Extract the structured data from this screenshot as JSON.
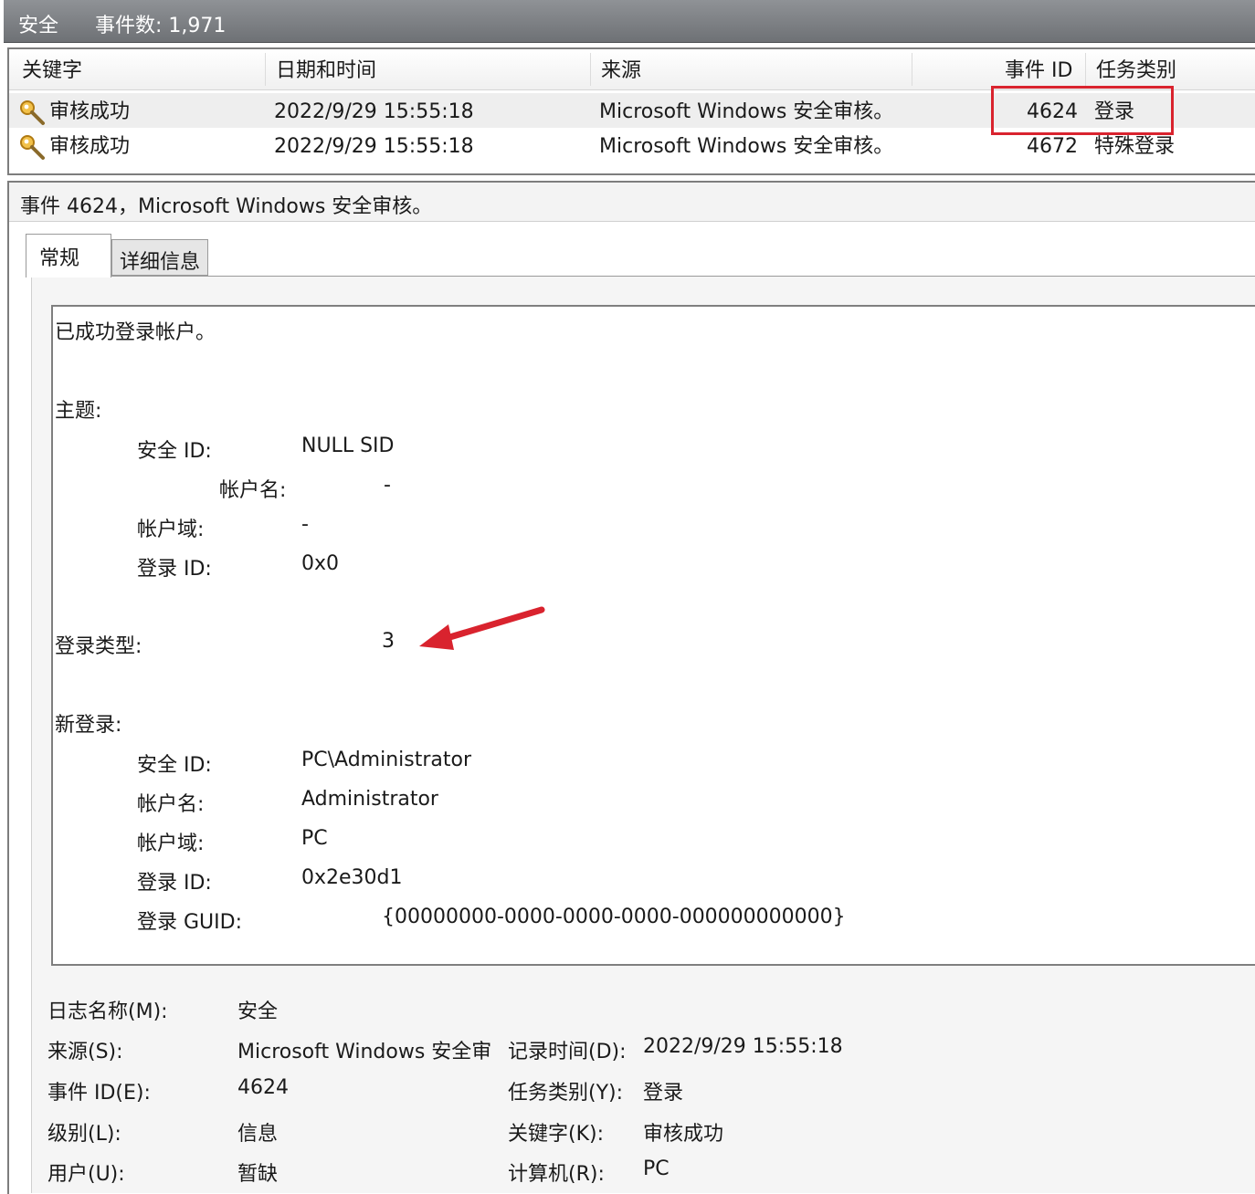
{
  "titlebar": {
    "log_name": "安全",
    "event_count": "事件数: 1,971"
  },
  "list": {
    "columns": {
      "keyword": "关键字",
      "datetime": "日期和时间",
      "source": "来源",
      "event_id": "事件 ID",
      "task_category": "任务类别"
    },
    "rows": [
      {
        "keyword": "审核成功",
        "datetime": "2022/9/29 15:55:18",
        "source": "Microsoft Windows 安全审核。",
        "event_id": "4624",
        "task_category": "登录"
      },
      {
        "keyword": "审核成功",
        "datetime": "2022/9/29 15:55:18",
        "source": "Microsoft Windows 安全审核。",
        "event_id": "4672",
        "task_category": "特殊登录"
      }
    ]
  },
  "detail": {
    "title": "事件 4624，Microsoft Windows 安全审核。",
    "tabs": {
      "general": "常规",
      "details": "详细信息"
    },
    "description": {
      "intro": "已成功登录帐户。",
      "subject_heading": "主题:",
      "subject": {
        "sid_label": "安全 ID:",
        "sid_value": "NULL SID",
        "account_name_label": "帐户名:",
        "account_name_value": "-",
        "account_domain_label": "帐户域:",
        "account_domain_value": "-",
        "logon_id_label": "登录 ID:",
        "logon_id_value": "0x0"
      },
      "logon_type_label": "登录类型:",
      "logon_type_value": "3",
      "new_logon_heading": "新登录:",
      "new_logon": {
        "sid_label": "安全 ID:",
        "sid_value": "PC\\Administrator",
        "account_name_label": "帐户名:",
        "account_name_value": "Administrator",
        "account_domain_label": "帐户域:",
        "account_domain_value": "PC",
        "logon_id_label": "登录 ID:",
        "logon_id_value": "0x2e30d1",
        "logon_guid_label": "登录 GUID:",
        "logon_guid_value": "{00000000-0000-0000-0000-000000000000}"
      }
    },
    "fields": {
      "log_name_label": "日志名称(M):",
      "log_name_value": "安全",
      "source_label": "来源(S):",
      "source_value": "Microsoft Windows 安全审",
      "logged_label": "记录时间(D):",
      "logged_value": "2022/9/29 15:55:18",
      "event_id_label": "事件 ID(E):",
      "event_id_value": "4624",
      "task_category_label": "任务类别(Y):",
      "task_category_value": "登录",
      "level_label": "级别(L):",
      "level_value": "信息",
      "keywords_label": "关键字(K):",
      "keywords_value": "审核成功",
      "user_label": "用户(U):",
      "user_value": "暂缺",
      "computer_label": "计算机(R):",
      "computer_value": "PC"
    }
  },
  "annotation_color": "#d9232e",
  "icons": [
    "key-icon",
    "arrow-annotation"
  ]
}
